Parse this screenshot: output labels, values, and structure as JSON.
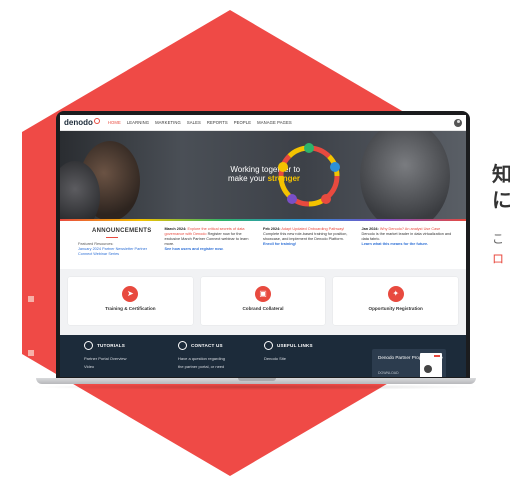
{
  "colors": {
    "accent": "#e84a3f",
    "hexagon": "#ef4a46",
    "navy": "#1c2b3a",
    "gold": "#f4c300"
  },
  "side": {
    "title_line1": "知",
    "title_line2": "に",
    "subtitle": "こ",
    "link": "ロ"
  },
  "nav": {
    "logo": "denodo",
    "items": [
      "HOME",
      "LEARNING",
      "MARKETING",
      "SALES",
      "REPORTS",
      "PEOPLE",
      "MANAGE PAGES"
    ],
    "user_icon": "user-icon"
  },
  "hero": {
    "line1": "Working together to",
    "line2_lead": "make your ",
    "line2_strong": "stronger"
  },
  "announcements": {
    "title": "ANNOUNCEMENTS",
    "featured_label": "Featured Resources:",
    "featured_link": "January 2024 Partner Newsletter Partner Connect Webinar Series",
    "items": [
      {
        "date": "March 2024:",
        "headline": "Explore the critical secrets of data governance with Denodo",
        "body": "Register now for the exclusive March Partner Connect webinar to learn more.",
        "more": "See how users and register now."
      },
      {
        "date": "Feb 2024:",
        "headline": "Adapt Updated Onboarding Pathway!",
        "body": "Complete this new role-based training for position, showcase, and implement the Denodo Platform.",
        "more": "Enroll for training!"
      },
      {
        "date": "Jan 2024:",
        "headline": "Why Denodo? An analyst Use Case",
        "body": "Denodo is the market leader in data virtualization and data fabric.",
        "more": "Learn what this means for the future."
      }
    ]
  },
  "cards": [
    {
      "label": "Training & Certification",
      "icon": "rocket-icon",
      "glyph": "➤"
    },
    {
      "label": "Cobrand Collateral",
      "icon": "briefcase-icon",
      "glyph": "▣"
    },
    {
      "label": "Opportunity Registration",
      "icon": "handshake-icon",
      "glyph": "✦"
    }
  ],
  "footer": {
    "tutorials": {
      "title": "TUTORIALS",
      "line1": "Partner Portal Overview",
      "line2": "Video"
    },
    "contact": {
      "title": "CONTACT US",
      "line1": "Have a question regarding",
      "line2": "the partner portal, or need"
    },
    "links": {
      "title": "USEFUL LINKS",
      "line1": "Denodo Site"
    },
    "guide": {
      "title": "Denodo Partner Program Guide",
      "sub": "DOWNLOAD"
    }
  }
}
